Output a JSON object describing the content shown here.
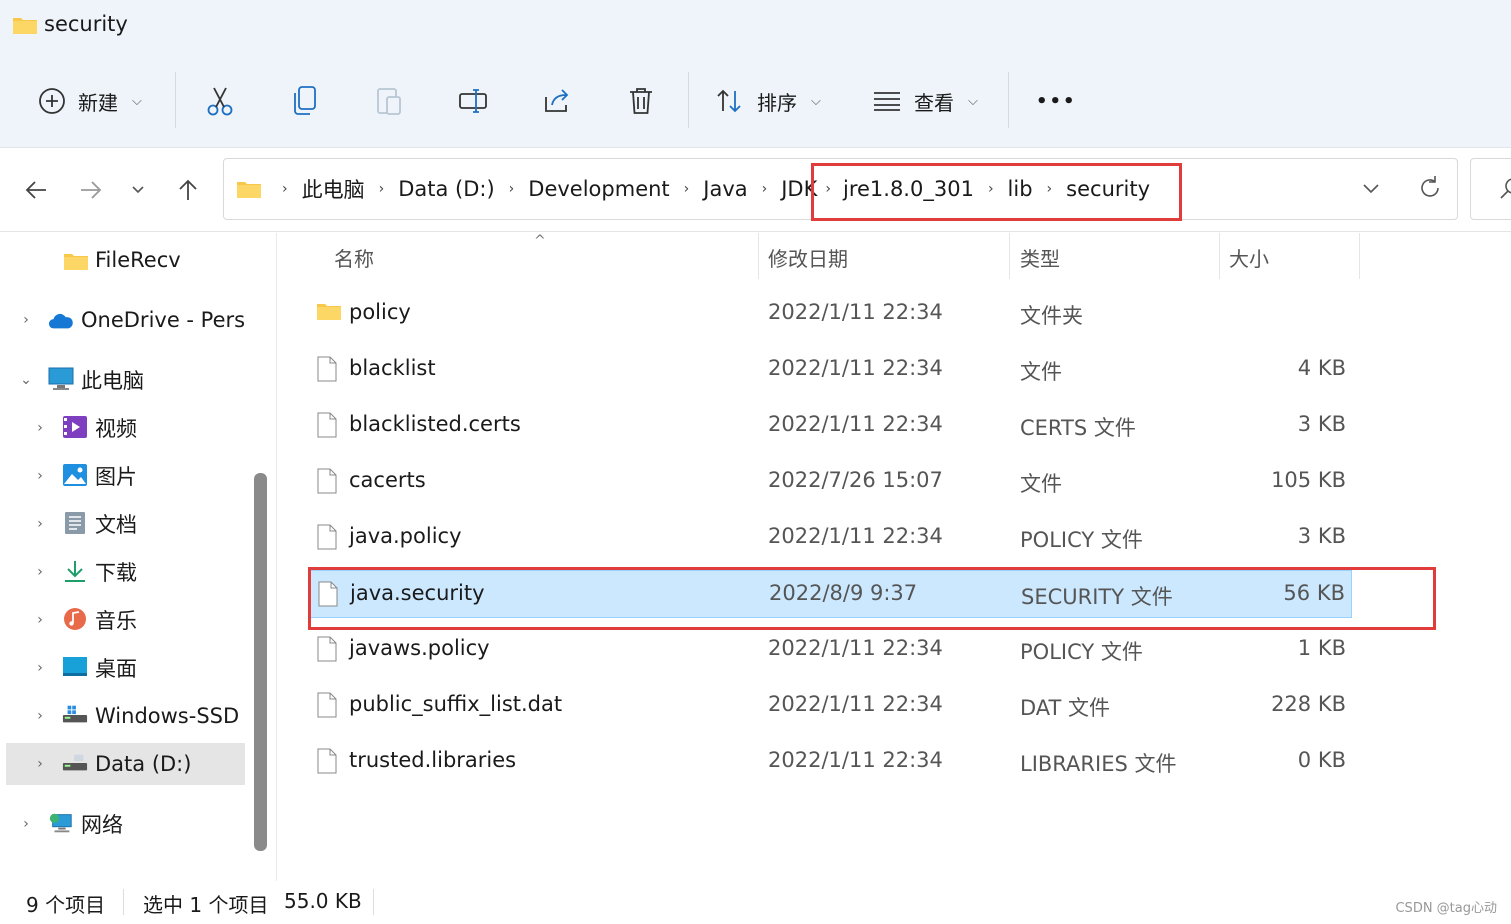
{
  "window": {
    "title": "security"
  },
  "toolbar": {
    "new_label": "新建",
    "sort_label": "排序",
    "view_label": "查看",
    "more_label": "•••"
  },
  "breadcrumb": {
    "items": [
      "此电脑",
      "Data (D:)",
      "Development",
      "Java",
      "JDK",
      "jre1.8.0_301",
      "lib",
      "security"
    ]
  },
  "sidebar": {
    "items": [
      {
        "label": "FileRecv"
      },
      {
        "label": "OneDrive - Perso"
      },
      {
        "label": "此电脑"
      },
      {
        "label": "视频"
      },
      {
        "label": "图片"
      },
      {
        "label": "文档"
      },
      {
        "label": "下载"
      },
      {
        "label": "音乐"
      },
      {
        "label": "桌面"
      },
      {
        "label": "Windows-SSD"
      },
      {
        "label": "Data (D:)"
      },
      {
        "label": "网络"
      }
    ]
  },
  "columns": {
    "name": "名称",
    "date": "修改日期",
    "type": "类型",
    "size": "大小"
  },
  "files": [
    {
      "name": "policy",
      "date": "2022/1/11 22:34",
      "type": "文件夹",
      "size": ""
    },
    {
      "name": "blacklist",
      "date": "2022/1/11 22:34",
      "type": "文件",
      "size": "4 KB"
    },
    {
      "name": "blacklisted.certs",
      "date": "2022/1/11 22:34",
      "type": "CERTS 文件",
      "size": "3 KB"
    },
    {
      "name": "cacerts",
      "date": "2022/7/26 15:07",
      "type": "文件",
      "size": "105 KB"
    },
    {
      "name": "java.policy",
      "date": "2022/1/11 22:34",
      "type": "POLICY 文件",
      "size": "3 KB"
    },
    {
      "name": "java.security",
      "date": "2022/8/9 9:37",
      "type": "SECURITY 文件",
      "size": "56 KB"
    },
    {
      "name": "javaws.policy",
      "date": "2022/1/11 22:34",
      "type": "POLICY 文件",
      "size": "1 KB"
    },
    {
      "name": "public_suffix_list.dat",
      "date": "2022/1/11 22:34",
      "type": "DAT 文件",
      "size": "228 KB"
    },
    {
      "name": "trusted.libraries",
      "date": "2022/1/11 22:34",
      "type": "LIBRARIES 文件",
      "size": "0 KB"
    }
  ],
  "status": {
    "count": "9 个项目",
    "selected": "选中 1 个项目",
    "selected_size": "55.0 KB"
  },
  "watermark": "CSDN @tag心动",
  "colors": {
    "accent": "#0067c0",
    "selection": "#cce8ff",
    "highlight_box": "#e03c3c",
    "folder": "#f8c84a"
  }
}
